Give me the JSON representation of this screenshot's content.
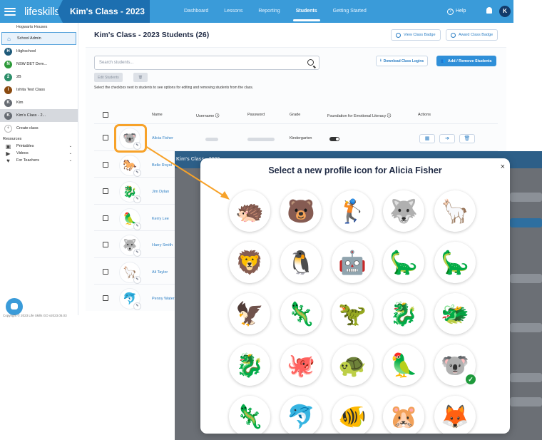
{
  "header": {
    "brand_prefix": "lifeskills",
    "brand_suffix": "GO",
    "class_title": "Kim's Class - 2023",
    "nav": [
      "Dashboard",
      "Lessons",
      "Reporting",
      "Students",
      "Getting Started"
    ],
    "active_nav": "Students",
    "help_label": "Help",
    "user_initial": "K"
  },
  "sidebar": {
    "heading": "Hogwarts Houses",
    "items": [
      {
        "label": "School Admin",
        "badge": "",
        "color": "#2b7ec4"
      },
      {
        "label": "Highschool",
        "badge": "H",
        "color": "#1f5a7a"
      },
      {
        "label": "NSW DET Dem...",
        "badge": "N",
        "color": "#2d9a3a"
      },
      {
        "label": "2B",
        "badge": "2",
        "color": "#2d8f6a"
      },
      {
        "label": "Ishita Test Class",
        "badge": "I",
        "color": "#8a4a10"
      },
      {
        "label": "Kim",
        "badge": "K",
        "color": "#666b72"
      },
      {
        "label": "Kim's Class - 2...",
        "badge": "K",
        "color": "#666b72"
      }
    ],
    "create_label": "Create class",
    "resources_label": "Resources",
    "resources": [
      "Printables",
      "Videos",
      "For Teachers"
    ],
    "copyright": "Copyright © 2023 Life Skills GO v2023.05.03"
  },
  "main": {
    "title": "Kim's Class - 2023 Students (26)",
    "view_badge": "View Class Badge",
    "award_badge": "Award Class Badge",
    "search_placeholder": "Search students...",
    "download_logins": "Download Class Logins",
    "add_remove": "Add / Remove Students",
    "edit_students": "Edit Students",
    "hint": "Select the checkbox next to students to see options for editing and removing students from the class.",
    "columns": [
      "Name",
      "Username",
      "Password",
      "Grade",
      "Foundation for Emotional Literacy",
      "Actions"
    ],
    "students": [
      {
        "name": "Alicia Fisher",
        "grade": "Kindergarten",
        "icon": "🐨"
      },
      {
        "name": "Belle Royal",
        "grade": "",
        "icon": "🐎"
      },
      {
        "name": "Jim Dylan",
        "grade": "",
        "icon": "🐉"
      },
      {
        "name": "Kerry Lee",
        "grade": "",
        "icon": "🦜"
      },
      {
        "name": "Harry Smith",
        "grade": "",
        "icon": "🐺"
      },
      {
        "name": "Ali Taylor",
        "grade": "",
        "icon": "🦙"
      },
      {
        "name": "Penny Waters",
        "grade": "",
        "icon": "🐬"
      }
    ]
  },
  "background_shot": {
    "title": "Kim's Class - 2023"
  },
  "modal": {
    "title": "Select a new profile icon for Alicia Fisher",
    "close": "×",
    "selected_index": 19,
    "icons": [
      {
        "name": "echidna",
        "glyph": "🦔"
      },
      {
        "name": "bear",
        "glyph": "🐻"
      },
      {
        "name": "golfer",
        "glyph": "🏌"
      },
      {
        "name": "husky",
        "glyph": "🐺"
      },
      {
        "name": "alpaca",
        "glyph": "🦙"
      },
      {
        "name": "lion",
        "glyph": "🦁"
      },
      {
        "name": "penguin",
        "glyph": "🐧"
      },
      {
        "name": "robot",
        "glyph": "🤖"
      },
      {
        "name": "triceratops",
        "glyph": "🦕"
      },
      {
        "name": "brachiosaurus",
        "glyph": "🦕"
      },
      {
        "name": "pterodactyl",
        "glyph": "🦅"
      },
      {
        "name": "stegosaurus",
        "glyph": "🦎"
      },
      {
        "name": "t-rex",
        "glyph": "🦖"
      },
      {
        "name": "ice-dragon",
        "glyph": "🐉"
      },
      {
        "name": "purple-dragon",
        "glyph": "🐲"
      },
      {
        "name": "orange-dragon",
        "glyph": "🐉"
      },
      {
        "name": "octopus",
        "glyph": "🐙"
      },
      {
        "name": "turtle",
        "glyph": "🐢"
      },
      {
        "name": "cockatoo",
        "glyph": "🦜"
      },
      {
        "name": "koala",
        "glyph": "🐨"
      },
      {
        "name": "gecko",
        "glyph": "🦎"
      },
      {
        "name": "dolphin",
        "glyph": "🐬"
      },
      {
        "name": "goldfish",
        "glyph": "🐠"
      },
      {
        "name": "hamster",
        "glyph": "🐹"
      },
      {
        "name": "fox",
        "glyph": "🦊"
      }
    ]
  },
  "colors": {
    "topbar": "#3a9bd9",
    "accent": "#2f8fd8",
    "highlight": "#f7a229",
    "selected_check": "#1f9a3c"
  }
}
